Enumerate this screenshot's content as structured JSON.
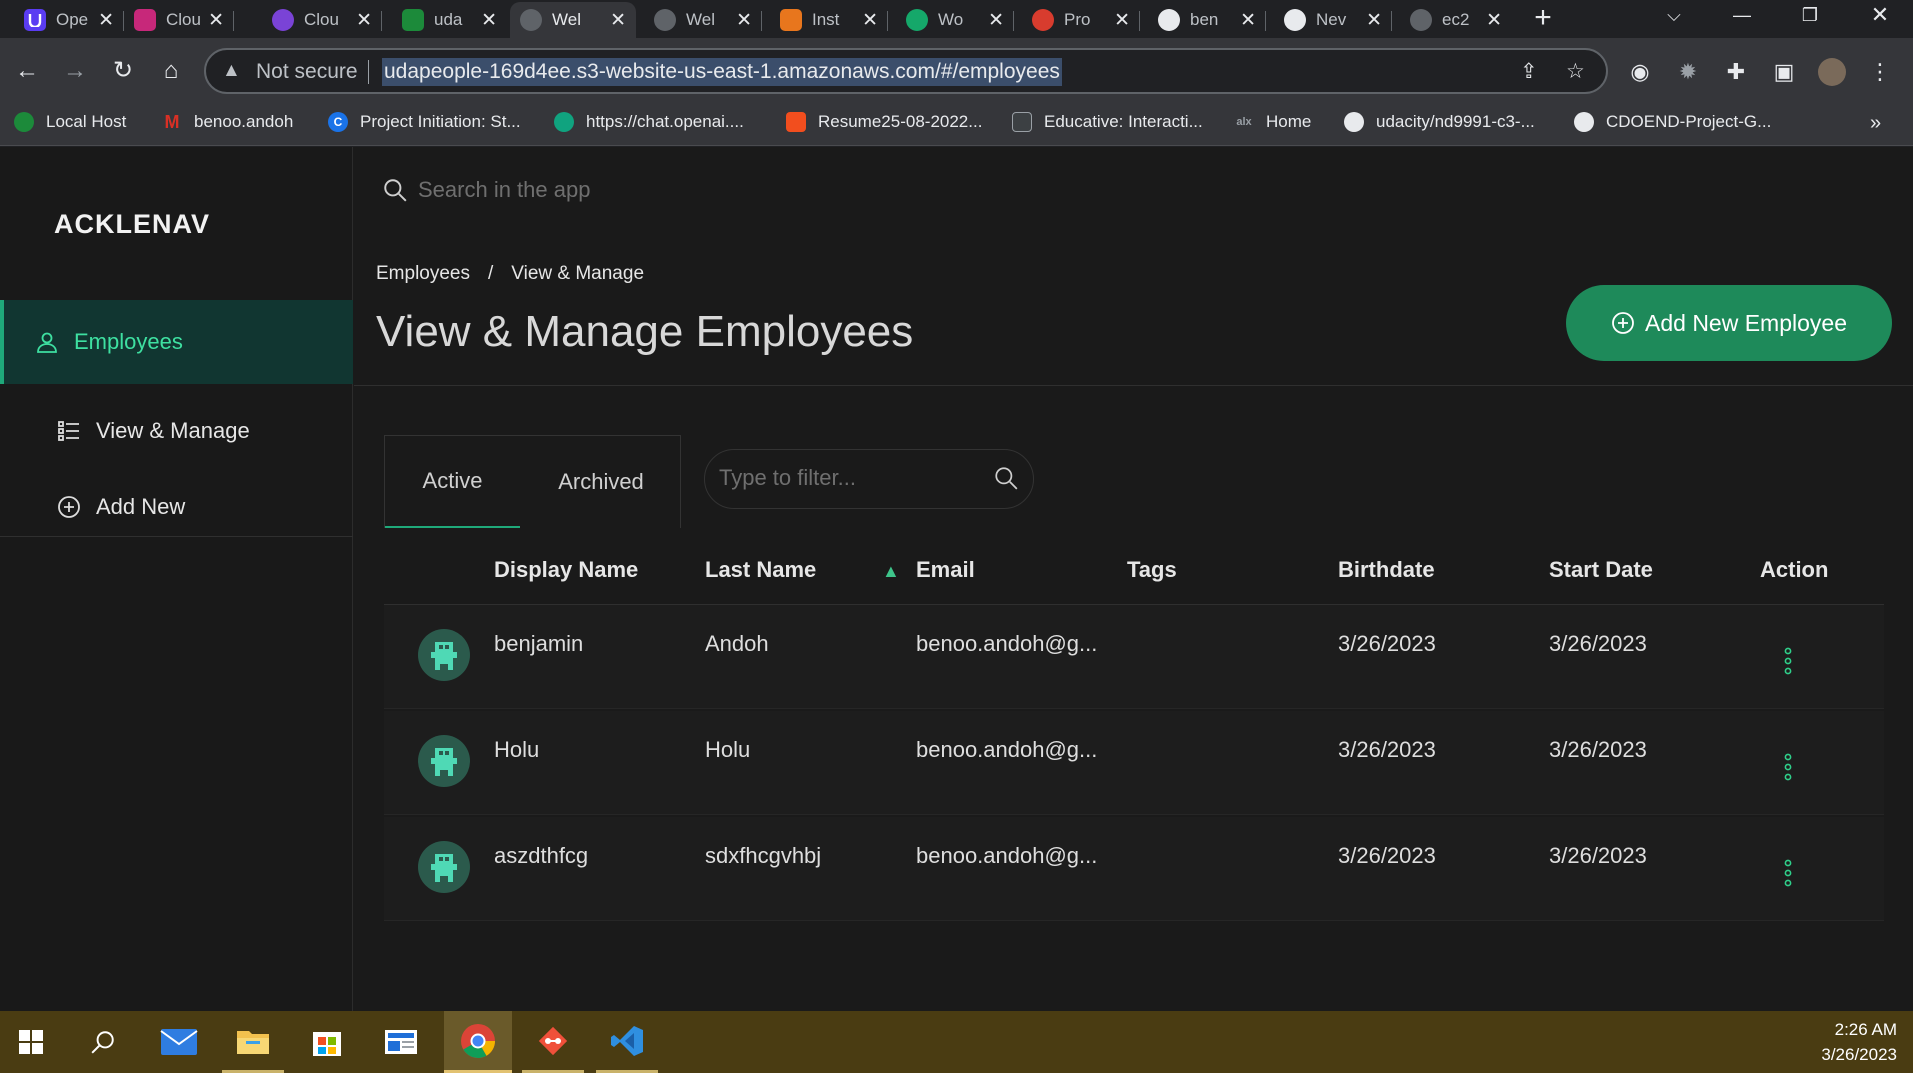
{
  "browser": {
    "tabs": [
      {
        "title": "Ope",
        "icon": "udacity-icon",
        "color": "#5a3cf2"
      },
      {
        "title": "Clou",
        "icon": "cloud-app-icon",
        "color": "#c7287a"
      },
      {
        "title": "Clou",
        "icon": "cloud-course-icon",
        "color": "#7a43d6"
      },
      {
        "title": "uda",
        "icon": "udacity-green-icon",
        "color": "#1c8a3a"
      },
      {
        "title": "Wel",
        "icon": "globe-icon",
        "color": "#5f6368"
      },
      {
        "title": "Wel",
        "icon": "globe-icon",
        "color": "#5f6368"
      },
      {
        "title": "Inst",
        "icon": "aws-instance-icon",
        "color": "#e8761d"
      },
      {
        "title": "Wo",
        "icon": "grammarly-icon",
        "color": "#15a86a"
      },
      {
        "title": "Pro",
        "icon": "proton-icon",
        "color": "#d83c2e"
      },
      {
        "title": "ben",
        "icon": "github-icon",
        "color": "#24292e"
      },
      {
        "title": "Nev",
        "icon": "chrome-icon",
        "color": "#5f6368"
      },
      {
        "title": "ec2",
        "icon": "globe-icon",
        "color": "#5f6368"
      }
    ],
    "address": {
      "security": "Not secure",
      "url": "udapeople-169d4ee.s3-website-us-east-1.amazonaws.com/#/employees"
    },
    "bookmarks": [
      {
        "label": "Local Host",
        "color": "#1c8a3a"
      },
      {
        "label": "benoo.andoh",
        "color": "#d93025"
      },
      {
        "label": "Project Initiation: St...",
        "color": "#1a73e8"
      },
      {
        "label": "https://chat.openai....",
        "color": "#10a37f"
      },
      {
        "label": "Resume25-08-2022...",
        "color": "#f24e1e"
      },
      {
        "label": "Educative: Interacti...",
        "color": "#3c4043"
      },
      {
        "label": "Home",
        "color": "#3c4043"
      },
      {
        "label": "udacity/nd9991-c3-...",
        "color": "#24292e"
      },
      {
        "label": "CDOEND-Project-G...",
        "color": "#24292e"
      }
    ],
    "more_bookmarks": "»"
  },
  "app": {
    "logo": "ACKLENAV",
    "sidebar": {
      "items": [
        {
          "label": "Employees",
          "icon": "user-icon"
        },
        {
          "label": "View & Manage",
          "icon": "list-icon"
        },
        {
          "label": "Add New",
          "icon": "plus-circle-icon"
        }
      ]
    },
    "search": {
      "placeholder": "Search in the app"
    },
    "breadcrumb": {
      "root": "Employees",
      "sep": "/",
      "current": "View & Manage"
    },
    "title": "View & Manage Employees",
    "add_button": "Add New Employee",
    "tabs": [
      "Active",
      "Archived"
    ],
    "filter": {
      "placeholder": "Type to filter..."
    },
    "columns": [
      "Display Name",
      "Last Name",
      "Email",
      "Tags",
      "Birthdate",
      "Start Date",
      "Action"
    ],
    "sort_column": "Email",
    "rows": [
      {
        "display_name": "benjamin",
        "last_name": "Andoh",
        "email": "benoo.andoh@g...",
        "tags": "",
        "birthdate": "3/26/2023",
        "start_date": "3/26/2023"
      },
      {
        "display_name": "Holu",
        "last_name": "Holu",
        "email": "benoo.andoh@g...",
        "tags": "",
        "birthdate": "3/26/2023",
        "start_date": "3/26/2023"
      },
      {
        "display_name": "aszdthfcg",
        "last_name": "sdxfhcgvhbj",
        "email": "benoo.andoh@g...",
        "tags": "",
        "birthdate": "3/26/2023",
        "start_date": "3/26/2023"
      }
    ],
    "accent": "#1e8a5a"
  },
  "taskbar": {
    "time": "2:26 AM",
    "date": "3/26/2023"
  }
}
